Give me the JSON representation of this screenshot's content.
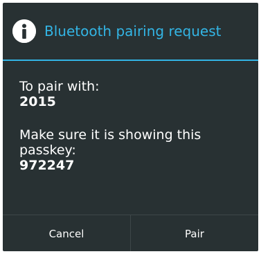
{
  "dialog": {
    "title": "Bluetooth pairing request",
    "icon": "info-icon",
    "pair_with_label": "To pair with:",
    "device_name": "2015",
    "passkey_prompt_line1": "Make sure it is showing this",
    "passkey_prompt_line2": "passkey:",
    "passkey": "972247"
  },
  "buttons": {
    "cancel_label": "Cancel",
    "pair_label": "Pair"
  },
  "colors": {
    "background": "#283133",
    "accent": "#33b5e5",
    "text": "#ffffff"
  }
}
